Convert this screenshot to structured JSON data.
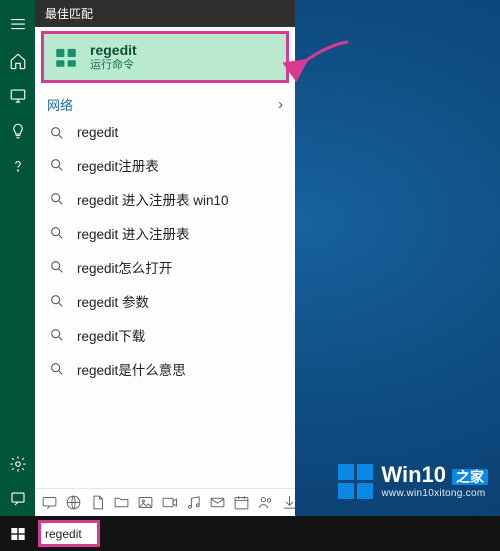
{
  "panel": {
    "section_best": "最佳匹配",
    "best": {
      "title": "regedit",
      "subtitle": "运行命令"
    },
    "section_net": "网络",
    "items": [
      "regedit",
      "regedit注册表",
      "regedit 进入注册表 win10",
      "regedit 进入注册表",
      "regedit怎么打开",
      "regedit 参数",
      "regedit下载",
      "regedit是什么意思"
    ]
  },
  "search": {
    "value": "regedit"
  },
  "brand": {
    "name": "Win10",
    "sub": "之家",
    "url": "www.win10xitong.com"
  }
}
